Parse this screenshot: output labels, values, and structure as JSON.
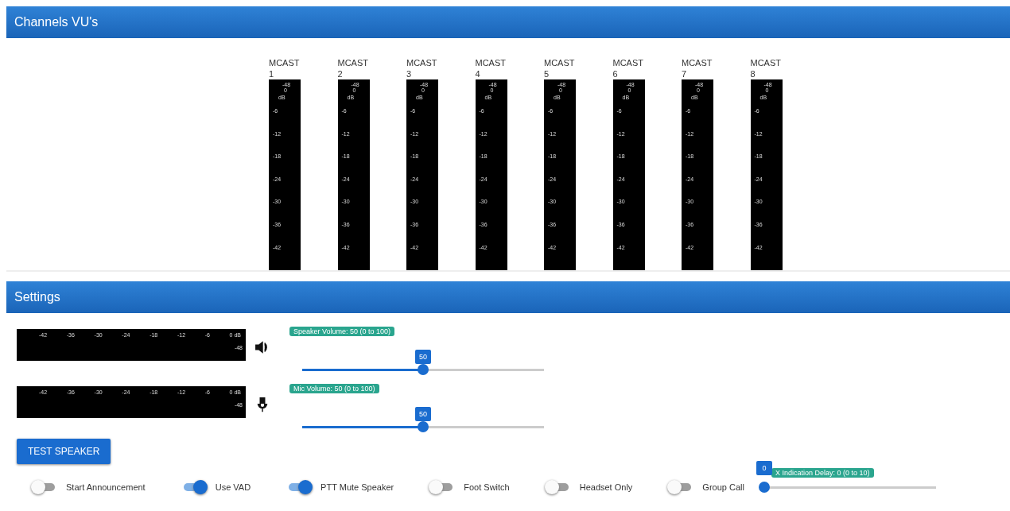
{
  "vu_panel": {
    "title": "Channels VU's",
    "channels": [
      {
        "name": "MCAST",
        "number": "1",
        "scale": [
          "-48",
          "0",
          "dB",
          "-6",
          "-12",
          "-18",
          "-24",
          "-30",
          "-36",
          "-42"
        ]
      },
      {
        "name": "MCAST",
        "number": "2",
        "scale": [
          "-48",
          "0",
          "dB",
          "-6",
          "-12",
          "-18",
          "-24",
          "-30",
          "-36",
          "-42"
        ]
      },
      {
        "name": "MCAST",
        "number": "3",
        "scale": [
          "-48",
          "0",
          "dB",
          "-6",
          "-12",
          "-18",
          "-24",
          "-30",
          "-36",
          "-42"
        ]
      },
      {
        "name": "MCAST",
        "number": "4",
        "scale": [
          "-48",
          "0",
          "dB",
          "-6",
          "-12",
          "-18",
          "-24",
          "-30",
          "-36",
          "-42"
        ]
      },
      {
        "name": "MCAST",
        "number": "5",
        "scale": [
          "-48",
          "0",
          "dB",
          "-6",
          "-12",
          "-18",
          "-24",
          "-30",
          "-36",
          "-42"
        ]
      },
      {
        "name": "MCAST",
        "number": "6",
        "scale": [
          "-48",
          "0",
          "dB",
          "-6",
          "-12",
          "-18",
          "-24",
          "-30",
          "-36",
          "-42"
        ]
      },
      {
        "name": "MCAST",
        "number": "7",
        "scale": [
          "-48",
          "0",
          "dB",
          "-6",
          "-12",
          "-18",
          "-24",
          "-30",
          "-36",
          "-42"
        ]
      },
      {
        "name": "MCAST",
        "number": "8",
        "scale": [
          "-48",
          "0",
          "dB",
          "-6",
          "-12",
          "-18",
          "-24",
          "-30",
          "-36",
          "-42"
        ]
      }
    ]
  },
  "settings": {
    "title": "Settings",
    "meters": [
      {
        "kind": "speaker",
        "scale": [
          "-42",
          "-36",
          "-30",
          "-24",
          "-18",
          "-12",
          "-6",
          "0 dB"
        ],
        "floor": "-48",
        "slider": {
          "label": "Speaker Volume: 50 (0 to 100)",
          "value": "50",
          "level": 0.5
        }
      },
      {
        "kind": "mic",
        "scale": [
          "-42",
          "-36",
          "-30",
          "-24",
          "-18",
          "-12",
          "-6",
          "0 dB"
        ],
        "floor": "-48",
        "slider": {
          "label": "Mic Volume: 50 (0 to 100)",
          "value": "50",
          "level": 0.5
        }
      }
    ],
    "test_button": "TEST SPEAKER",
    "toggles": [
      {
        "label": "Start Announcement",
        "on": false
      },
      {
        "label": "Use VAD",
        "on": true
      },
      {
        "label": "PTT Mute Speaker",
        "on": true
      },
      {
        "label": "Foot Switch",
        "on": false
      },
      {
        "label": "Headset Only",
        "on": false
      },
      {
        "label": "Group Call",
        "on": false
      }
    ],
    "delay_slider": {
      "label": "X Indication Delay: 0 (0 to 10)",
      "value": "0",
      "level": 0
    }
  }
}
